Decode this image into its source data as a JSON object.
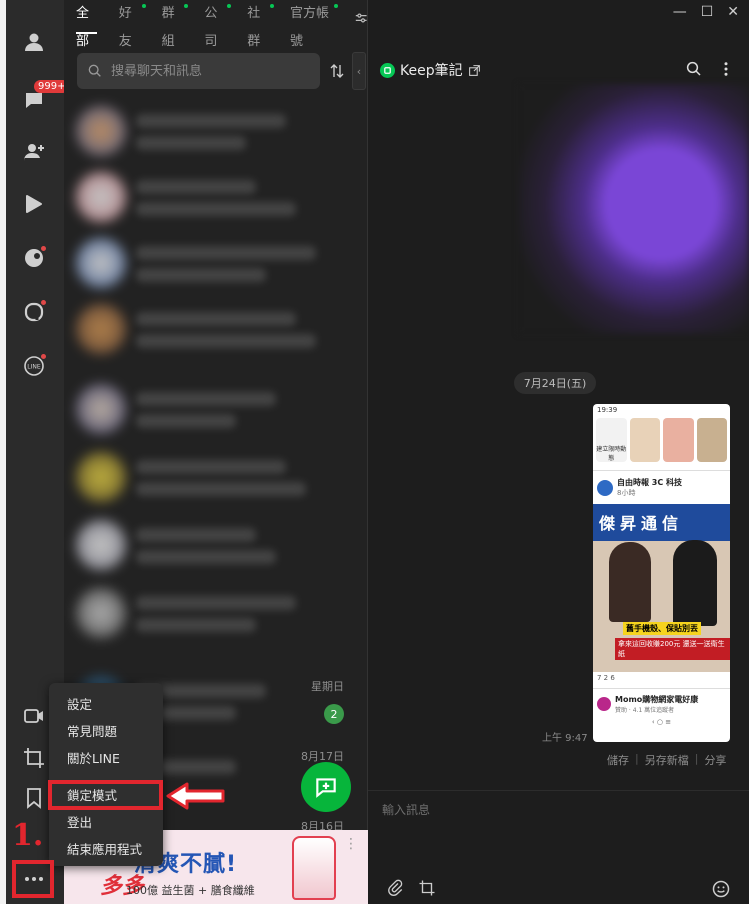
{
  "tabs": [
    {
      "label": "全部",
      "active": true,
      "dot": false
    },
    {
      "label": "好友",
      "active": false,
      "dot": true
    },
    {
      "label": "群組",
      "active": false,
      "dot": true
    },
    {
      "label": "公司",
      "active": false,
      "dot": true
    },
    {
      "label": "社群",
      "active": false,
      "dot": true
    },
    {
      "label": "官方帳號",
      "active": false,
      "dot": true
    }
  ],
  "rail": {
    "badge": "999+"
  },
  "search": {
    "placeholder": "搜尋聊天和訊息"
  },
  "chat_list": {
    "row8_date": "星期日",
    "row8_unread": "2",
    "row9_date": "8月17日",
    "row10_date": "8月16日"
  },
  "ad": {
    "brand": "多多",
    "headline": "清爽不膩!",
    "sub": "100億 益生菌 + 膳食纖維"
  },
  "menu": {
    "items": [
      "設定",
      "常見問題",
      "關於LINE",
      "鎖定模式",
      "登出",
      "結束應用程式"
    ]
  },
  "annotation": {
    "step": "1."
  },
  "chat": {
    "title": "Keep筆記",
    "date_separator": "7月24日(五)",
    "time": "上午 9:47",
    "actions": [
      "儲存",
      "另存新檔",
      "分享"
    ],
    "input_placeholder": "輸入訊息"
  },
  "shared_screenshot": {
    "status_time": "19:39",
    "story_label": "建立限時動態",
    "post1_author": "自由時報 3C 科技",
    "post1_meta": "8小時",
    "sign": "傑昇通信",
    "caption1": "舊手機殼、保貼別丟",
    "caption2": "拿來這回收賺200元 還送一送衛生紙",
    "reactions": "7  2  6",
    "post2_author": "Momo購物網家電好康",
    "post2_meta": "贊助 · 4.1 萬位追蹤者"
  },
  "colors": {
    "accent": "#06c755",
    "highlight": "#e2262e"
  }
}
